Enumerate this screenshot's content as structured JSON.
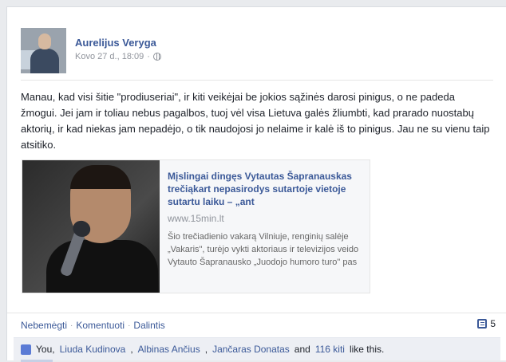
{
  "post": {
    "author": "Aurelijus Veryga",
    "timestamp": "Kovo 27 d., 18:09",
    "audience_icon": "globe-icon",
    "message": "Manau, kad visi šitie \"prodiuseriai\", ir kiti veikėjai be jokios sąžinės darosi pinigus, o ne padeda žmogui. Jei jam ir toliau nebus pagalbos, tuoj vėl visa Lietuva galės žliumbti, kad prarado nuostabų aktorių, ir kad niekas jam nepadėjo, o tik naudojosi jo nelaime ir kalė iš to pinigus. Jau ne su vienu taip atsitiko."
  },
  "shared_link": {
    "title": "Mįslingai dingęs Vytautas Šapranauskas trečiąkart nepasirodys sutartoje vietoje sutartu laiku – „ant",
    "domain": "www.15min.lt",
    "description": "Šio trečiadienio vakarą Vilniuje, renginių salėje „Vakaris\", turėjo vykti aktoriaus ir televizijos veido Vytauto Šapranausko „Juodojo humoro turo\" pas"
  },
  "actions": {
    "unlike": "Nebemėgti",
    "comment": "Komentuoti",
    "share": "Dalintis",
    "separator": "·"
  },
  "comment_count": "5",
  "likes": {
    "you": "You,",
    "people": [
      "Liuda Kudinova",
      "Albinas Ančius",
      "Jančaras Donatas"
    ],
    "and": "and",
    "others": "116 kiti",
    "suffix": "like this."
  },
  "colors": {
    "link": "#3b5998",
    "muted": "#90949c",
    "likes_bg": "#edeff4"
  }
}
